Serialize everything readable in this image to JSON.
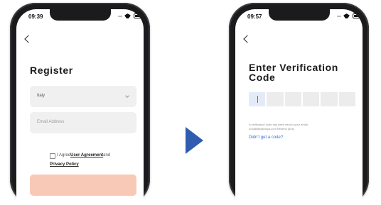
{
  "left_screen": {
    "status_time": "09:39",
    "title": "Register",
    "country_value": "Italy",
    "email_placeholder": "Email Address",
    "agree_prefix": "I Agree",
    "user_agreement_link": "User Agreement",
    "agree_and": "and",
    "privacy_policy_link": "Privacy Policy"
  },
  "right_screen": {
    "status_time": "09:57",
    "title_line1": "Enter Verification",
    "title_line2": "Code",
    "code_length": 6,
    "hint_line1": "A verification code has been sent to your email",
    "hint_line2": "20488@ta@tuya.com  Resend (52s)",
    "resend_link": "Didn't get a code?"
  },
  "colors": {
    "register_button": "#f9c9b7",
    "link_blue": "#3a6fd8",
    "arrow_blue": "#2e5db0"
  }
}
